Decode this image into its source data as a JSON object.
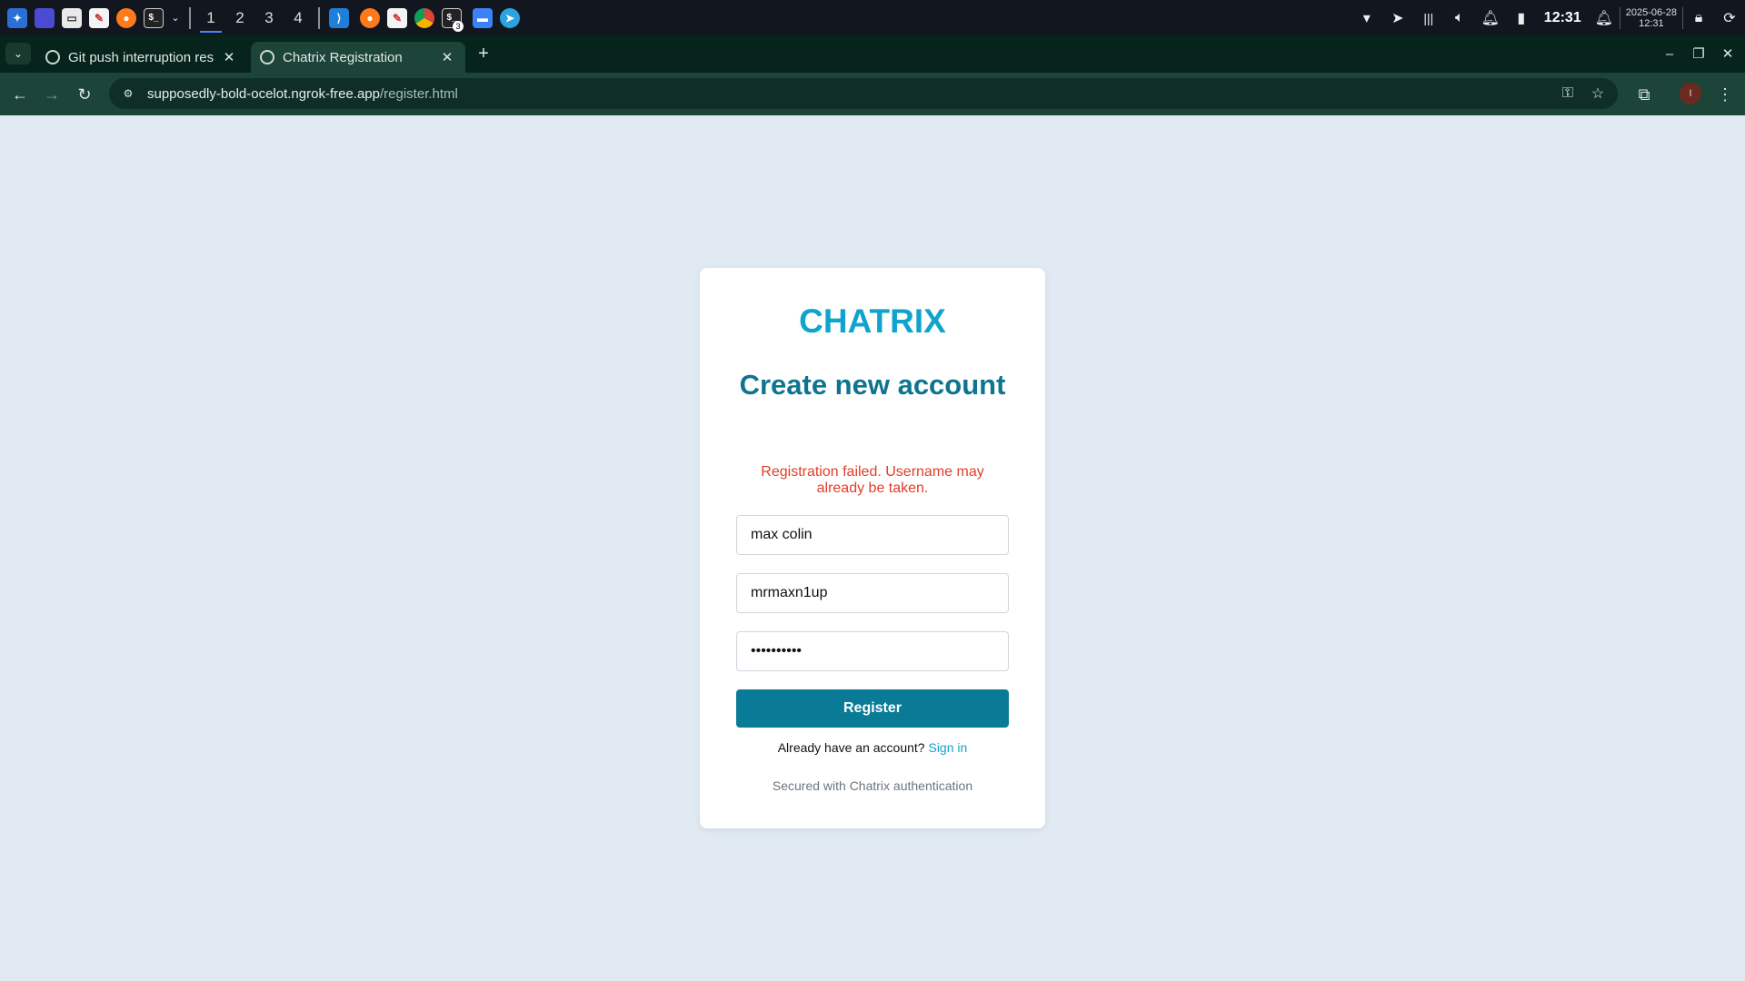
{
  "taskbar": {
    "workspaces": [
      "1",
      "2",
      "3",
      "4"
    ],
    "terminal_badge": "3",
    "clock": "12:31",
    "date": "2025-06-28",
    "date_time": "12:31"
  },
  "browser": {
    "tabs": [
      {
        "title": "Git push interruption res",
        "active": false
      },
      {
        "title": "Chatrix Registration",
        "active": true
      }
    ],
    "url_host": "supposedly-bold-ocelot.ngrok-free.app",
    "url_path": "/register.html",
    "profile_initial": "I"
  },
  "page": {
    "brand": "CHATRIX",
    "heading": "Create new account",
    "error_message": "Registration failed. Username may already be taken.",
    "fields": {
      "full_name": "max colin",
      "username": "mrmaxn1up",
      "password": "••••••••••"
    },
    "register_label": "Register",
    "signin_prompt": "Already have an account?",
    "signin_link": "Sign in",
    "footer_note": "Secured with Chatrix authentication"
  },
  "colors": {
    "page_background": "#e1eaf3",
    "brand": "#0fa4cc",
    "heading": "#0e7490",
    "error": "#e23d28",
    "button": "#0a7b96",
    "browser_frame": "#1c4438"
  }
}
